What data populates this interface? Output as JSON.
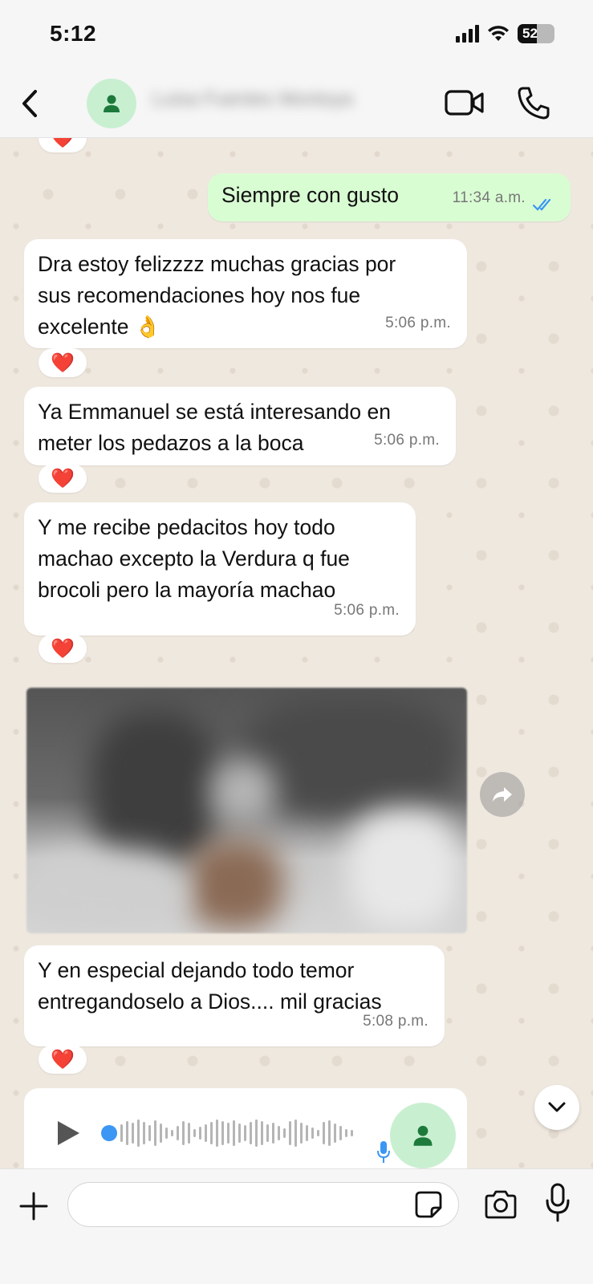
{
  "status_bar": {
    "time": "5:12",
    "battery": "52",
    "battery_level": 0.52
  },
  "header": {
    "contact_name": "Luisa Fuentes Montoya"
  },
  "messages": [
    {
      "direction": "out",
      "text": "Siempre con gusto",
      "time": "11:34 a.m.",
      "read": true
    },
    {
      "direction": "in",
      "lines": [
        "Dra estoy felizzzz muchas gracias por",
        "sus recomendaciones hoy nos fue",
        "excelente 👌"
      ],
      "time": "5:06 p.m.",
      "reaction": "❤️"
    },
    {
      "direction": "in",
      "lines": [
        "Ya Emmanuel se está interesando en",
        "meter los pedazos a la boca"
      ],
      "time": "5:06 p.m.",
      "reaction": "❤️"
    },
    {
      "direction": "in",
      "lines": [
        "Y me recibe pedacitos hoy todo",
        "machao excepto la Verdura q fue",
        "brocoli pero la mayoría machao"
      ],
      "time": "5:06 p.m.",
      "reaction": "❤️"
    },
    {
      "direction": "in",
      "lines": [
        "Y en especial dejando todo temor",
        "entregandoselo a Dios.... mil gracias"
      ],
      "time": "5:08 p.m.",
      "reaction": "❤️"
    }
  ],
  "top_reaction": "❤️",
  "input": {
    "placeholder": ""
  },
  "icons": {
    "back": "chevron-left-icon",
    "video": "video-camera-icon",
    "call": "phone-icon",
    "forward": "forward-icon",
    "scroll": "chevron-down-icon",
    "play": "play-icon",
    "plus": "plus-icon",
    "sticker": "sticker-icon",
    "camera": "camera-icon",
    "mic": "microphone-icon"
  },
  "colors": {
    "outgoing_bubble": "#d9fdd3",
    "incoming_bubble": "#ffffff",
    "read_ticks": "#3b96f4",
    "avatar_bg": "#c9efd1",
    "avatar_fg": "#1d7a3a"
  }
}
